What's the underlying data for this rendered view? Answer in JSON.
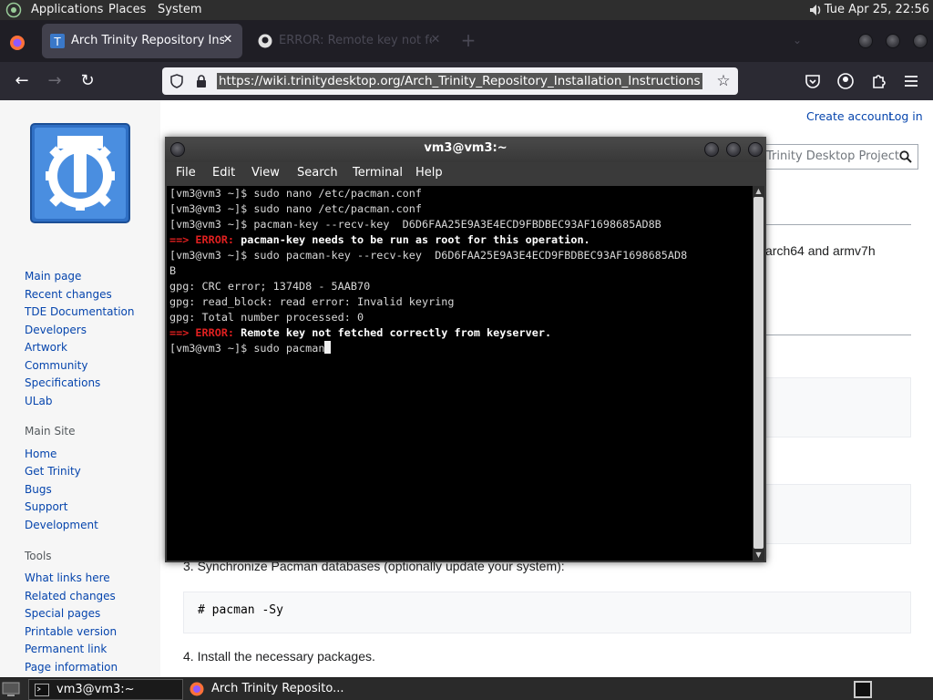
{
  "top_panel": {
    "menus": [
      "Applications",
      "Places",
      "System"
    ],
    "clock": "Tue Apr 25, 22:56"
  },
  "browser": {
    "tabs": [
      {
        "title": "Arch Trinity Repository Installation Instructions",
        "close": "✕"
      },
      {
        "title": "ERROR: Remote key not fetched",
        "close": "✕"
      }
    ],
    "new_tab": "+",
    "url": "https://wiki.trinitydesktop.org/Arch_Trinity_Repository_Installation_Instructions"
  },
  "page": {
    "personal_links": [
      "Create account",
      "Log in"
    ],
    "search_placeholder": "Search Trinity Desktop Project",
    "sidebar": {
      "nav": [
        "Main page",
        "Recent changes",
        "TDE Documentation",
        "Developers",
        "Artwork",
        "Community",
        "Specifications",
        "ULab"
      ],
      "main_site_heading": "Main Site",
      "main_site": [
        "Home",
        "Get Trinity",
        "Bugs",
        "Support",
        "Development"
      ],
      "tools_heading": "Tools",
      "tools": [
        "What links here",
        "Related changes",
        "Special pages",
        "Printable version",
        "Permanent link",
        "Page information"
      ]
    },
    "content": {
      "arch_text": "arch64 and armv7h",
      "step3": "3. Synchronize Pacman databases (optionally update your system):",
      "step3_code": "# pacman -Sy",
      "step4": "4. Install the necessary packages."
    }
  },
  "terminal": {
    "title": "vm3@vm3:~",
    "menus": [
      "File",
      "Edit",
      "View",
      "Search",
      "Terminal",
      "Help"
    ],
    "lines": [
      {
        "text": "[vm3@vm3 ~]$ sudo nano /etc/pacman.conf"
      },
      {
        "text": "[vm3@vm3 ~]$ sudo nano /etc/pacman.conf"
      },
      {
        "text": "[vm3@vm3 ~]$ pacman-key --recv-key  D6D6FAA25E9A3E4ECD9FBDBEC93AF1698685AD8B"
      },
      {
        "arrow": "==> ERROR:",
        "msg": " pacman-key needs to be run as root for this operation."
      },
      {
        "text": "[vm3@vm3 ~]$ sudo pacman-key --recv-key  D6D6FAA25E9A3E4ECD9FBDBEC93AF1698685AD8"
      },
      {
        "text": "B"
      },
      {
        "text": "gpg: CRC error; 1374D8 - 5AAB70"
      },
      {
        "text": "gpg: read_block: read error: Invalid keyring"
      },
      {
        "text": "gpg: Total number processed: 0"
      },
      {
        "arrow": "==> ERROR:",
        "msg": " Remote key not fetched correctly from keyserver."
      },
      {
        "text": "[vm3@vm3 ~]$ sudo pacman"
      }
    ]
  },
  "taskbar": {
    "items": [
      "vm3@vm3:~",
      "Arch Trinity Reposito..."
    ]
  }
}
